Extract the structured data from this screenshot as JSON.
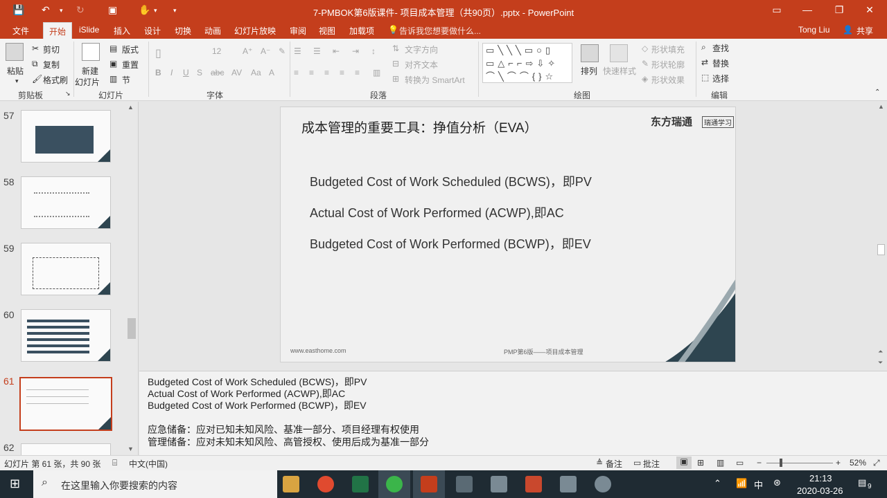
{
  "titlebar": {
    "title": "7-PMBOK第6版课件- 项目成本管理（共90页）.pptx - PowerPoint"
  },
  "menu": {
    "items": [
      "文件",
      "开始",
      "iSlide",
      "插入",
      "设计",
      "切换",
      "动画",
      "幻灯片放映",
      "审阅",
      "视图",
      "加载项"
    ],
    "tell_me": "告诉我您想要做什么...",
    "user": "Tong Liu",
    "share": "共享"
  },
  "ribbon": {
    "clipboard": {
      "paste": "粘贴",
      "cut": "剪切",
      "copy": "复制",
      "format_painter": "格式刷",
      "label": "剪贴板"
    },
    "slides": {
      "new_slide_1": "新建",
      "new_slide_2": "幻灯片",
      "layout": "版式",
      "reset": "重置",
      "section": "节",
      "label": "幻灯片"
    },
    "font": {
      "label": "字体",
      "size": "12"
    },
    "paragraph": {
      "text_direction": "文字方向",
      "align_text": "对齐文本",
      "smartart": "转换为 SmartArt",
      "label": "段落"
    },
    "drawing": {
      "arrange": "排列",
      "quick_styles": "快速样式",
      "shape_fill": "形状填充",
      "shape_outline": "形状轮廓",
      "shape_effects": "形状效果",
      "label": "绘图"
    },
    "editing": {
      "find": "查找",
      "replace": "替换",
      "select": "选择",
      "label": "编辑"
    }
  },
  "thumbnails": [
    {
      "num": "57"
    },
    {
      "num": "58"
    },
    {
      "num": "59"
    },
    {
      "num": "60"
    },
    {
      "num": "61"
    },
    {
      "num": "62"
    }
  ],
  "slide": {
    "title": "成本管理的重要工具：挣值分析（EVA）",
    "logo": "东方瑞通",
    "logo_sub": "瑞通学习",
    "lines": [
      "Budgeted Cost of Work Scheduled (BCWS)，即PV",
      "Actual Cost of Work Performed (ACWP),即AC",
      "Budgeted Cost of Work Performed (BCWP)，即EV"
    ],
    "footer_left": "www.easthome.com",
    "footer_mid": "PMP第6版——项目成本管理",
    "page": "61"
  },
  "notes": {
    "lines": [
      "Budgeted Cost of Work Scheduled (BCWS)，即PV",
      "Actual Cost of Work Performed (ACWP),即AC",
      "Budgeted Cost of Work Performed (BCWP)，即EV",
      "应急储备：应对已知未知风险、基准一部分、项目经理有权使用",
      "管理储备：应对未知未知风险、高管授权、使用后成为基准一部分"
    ]
  },
  "status": {
    "slide_info": "幻灯片 第 61 张，共 90 张",
    "language": "中文(中国)",
    "notes": "备注",
    "comments": "批注",
    "zoom": "52%"
  },
  "taskbar": {
    "search_placeholder": "在这里输入你要搜索的内容",
    "ime": "中",
    "time": "21:13",
    "date": "2020-03-26",
    "notif_count": "9"
  },
  "colors": {
    "accent": "#c43e1c",
    "slide_dark": "#2e4550",
    "taskbar": "#1f2b33"
  }
}
